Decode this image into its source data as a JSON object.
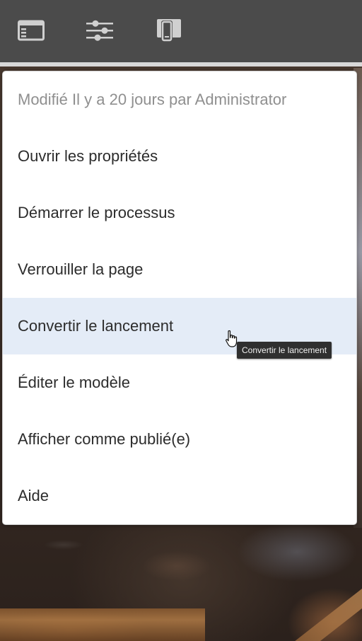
{
  "toolbar": {
    "icons": [
      "side-panel-icon",
      "properties-sliders-icon",
      "emulator-devices-icon"
    ],
    "background_color": "#4b4b4b",
    "icon_color": "#d0d0d0"
  },
  "menu": {
    "header_text": "Modifié Il y a 20 jours par Administrator",
    "items": [
      {
        "label": "Ouvrir les propriétés"
      },
      {
        "label": "Démarrer le processus"
      },
      {
        "label": "Verrouiller la page"
      },
      {
        "label": "Convertir le lancement",
        "hovered": true
      },
      {
        "label": "Éditer le modèle"
      },
      {
        "label": "Afficher comme publié(e)"
      },
      {
        "label": "Aide"
      }
    ],
    "hover_color": "#e4ecf7"
  },
  "tooltip": {
    "text": "Convertir le lancement"
  },
  "cursor": {
    "icon": "hand-pointer-icon"
  }
}
